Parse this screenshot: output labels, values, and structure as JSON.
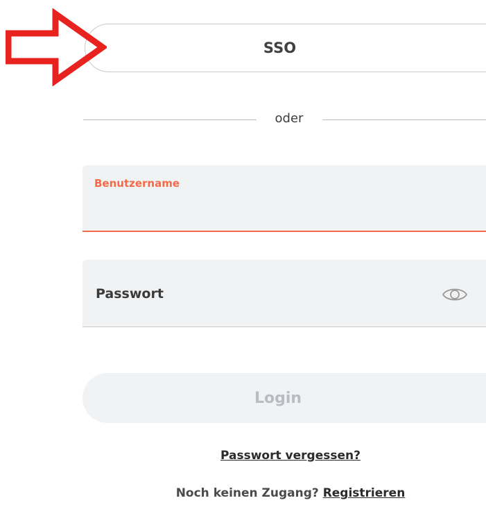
{
  "sso_button": {
    "label": "SSO"
  },
  "divider": {
    "text": "oder"
  },
  "username": {
    "label": "Benutzername",
    "value": ""
  },
  "password": {
    "placeholder": "Passwort",
    "value": ""
  },
  "login_button": {
    "label": "Login"
  },
  "forgot_password": {
    "label": "Passwort vergessen?"
  },
  "register": {
    "prompt": "Noch keinen Zugang?",
    "link_label": "Registrieren"
  },
  "annotation": {
    "icon": "arrow-right-icon",
    "color": "#e8231f"
  },
  "colors": {
    "accent": "#f26a48",
    "field_background": "#f1f2f4",
    "disabled_text": "#b9bcc2",
    "annotation_red": "#e8231f"
  }
}
